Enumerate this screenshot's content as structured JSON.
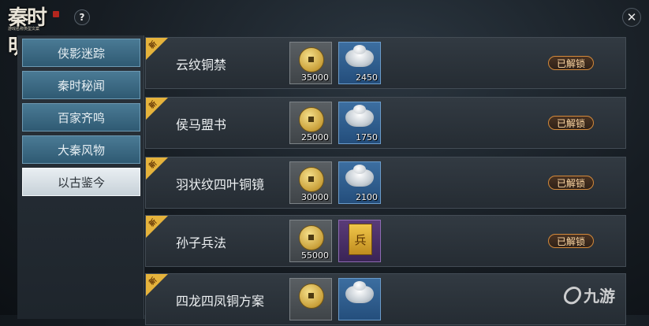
{
  "header": {
    "logo_text": "秦时明月",
    "logo_tagline": "游戏名称类型文案",
    "help_label": "?",
    "close_label": "✕"
  },
  "menu": {
    "items": [
      {
        "label": "侠影迷踪",
        "active": false
      },
      {
        "label": "秦时秘闻",
        "active": false
      },
      {
        "label": "百家齐鸣",
        "active": false
      },
      {
        "label": "大秦风物",
        "active": false
      },
      {
        "label": "以古鉴今",
        "active": true
      }
    ]
  },
  "list": {
    "new_badge": "新",
    "items": [
      {
        "name": "云纹铜禁",
        "coin_cost": "35000",
        "second_cost": "2450",
        "second_icon": "silver-ingot-icon",
        "status": "已解锁"
      },
      {
        "name": "侯马盟书",
        "coin_cost": "25000",
        "second_cost": "1750",
        "second_icon": "silver-ingot-icon",
        "status": "已解锁"
      },
      {
        "name": "羽状纹四叶铜镜",
        "coin_cost": "30000",
        "second_cost": "2100",
        "second_icon": "silver-ingot-icon",
        "status": "已解锁"
      },
      {
        "name": "孙子兵法",
        "coin_cost": "55000",
        "second_cost": "",
        "second_icon": "book-icon",
        "book_glyph": "兵",
        "status": "已解锁"
      },
      {
        "name": "四龙四凤铜方案",
        "coin_cost": "",
        "second_cost": "",
        "second_icon": "silver-ingot-icon",
        "status": ""
      }
    ]
  },
  "watermark": {
    "text": "九游"
  },
  "colors": {
    "menu_item": "#3f6d88",
    "menu_active": "#dfe6eb",
    "new_tag": "#e5b33c",
    "status_border": "#d3893a"
  }
}
